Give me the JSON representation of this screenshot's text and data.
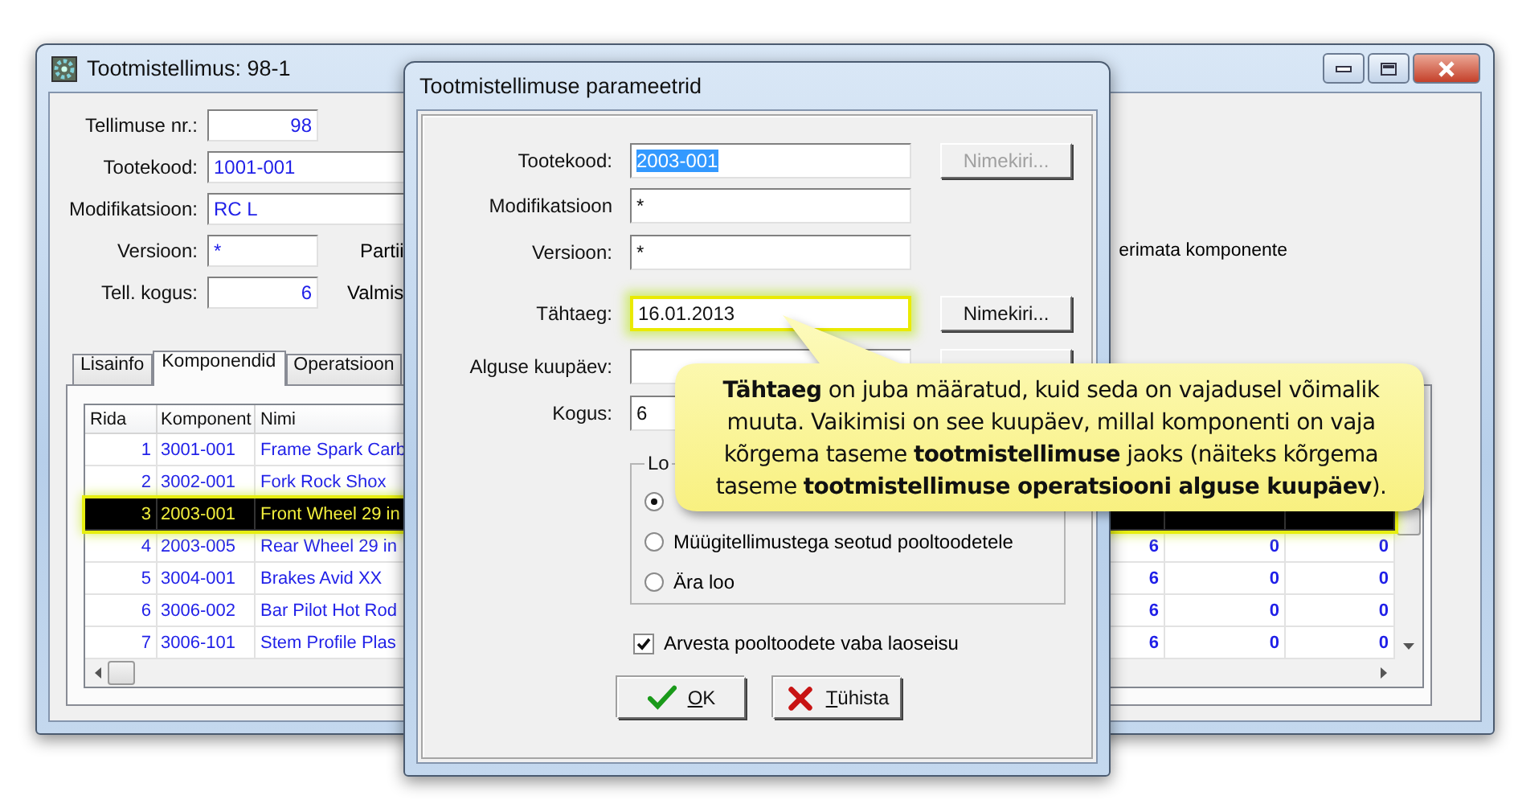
{
  "main_window": {
    "title": "Tootmistellimus: 98-1",
    "fields": [
      {
        "label": "Tellimuse nr.:",
        "value": "98",
        "kind": "number"
      },
      {
        "label": "Tootekood:",
        "value": "1001-001",
        "kind": "text"
      },
      {
        "label": "Modifikatsioon:",
        "value": "RC L",
        "kind": "text"
      },
      {
        "label": "Versioon:",
        "value": "*",
        "kind": "short",
        "side_label": "Partii",
        "far_label": "erimata komponente"
      },
      {
        "label": "Tell. kogus:",
        "value": "6",
        "kind": "number",
        "side_label": "Valmis"
      }
    ],
    "tabs": [
      {
        "label": "Lisainfo",
        "selected": false
      },
      {
        "label": "Komponendid",
        "selected": true
      },
      {
        "label": "Operatsioon",
        "selected": false
      }
    ],
    "table": {
      "columns": [
        "Rida",
        "Komponent",
        "Nimi"
      ],
      "rows": [
        {
          "cells": [
            "1",
            "3001-001",
            "Frame Spark Carb"
          ],
          "selected": false
        },
        {
          "cells": [
            "2",
            "3002-001",
            "Fork Rock Shox"
          ],
          "selected": false
        },
        {
          "cells": [
            "3",
            "2003-001",
            "Front Wheel 29 in"
          ],
          "selected": true
        },
        {
          "cells": [
            "4",
            "2003-005",
            "Rear Wheel 29 in",
            "6",
            "0",
            "0"
          ],
          "selected": false
        },
        {
          "cells": [
            "5",
            "3004-001",
            "Brakes Avid XX",
            "6",
            "0",
            "0"
          ],
          "selected": false
        },
        {
          "cells": [
            "6",
            "3006-002",
            "Bar Pilot Hot Rod",
            "6",
            "0",
            "0"
          ],
          "selected": false
        },
        {
          "cells": [
            "7",
            "3006-101",
            "Stem Profile Plas",
            "6",
            "0",
            "0"
          ],
          "selected": false
        }
      ]
    }
  },
  "dialog": {
    "title": "Tootmistellimuse parameetrid",
    "fields": [
      {
        "label": "Tootekood:",
        "value": "2003-001",
        "text_selected": true,
        "highlighted": false,
        "button": {
          "label": "Nimekiri...",
          "disabled": true
        }
      },
      {
        "label": "Modifikatsioon",
        "value": "*",
        "text_selected": false,
        "highlighted": false
      },
      {
        "label": "Versioon:",
        "value": "*",
        "text_selected": false,
        "highlighted": false
      },
      {
        "label": "Tähtaeg:",
        "value": "16.01.2013",
        "text_selected": false,
        "highlighted": true,
        "button": {
          "label": "Nimekiri...",
          "disabled": false
        }
      },
      {
        "label": "Alguse kuupäev:",
        "highlighted": false,
        "list_button": true
      },
      {
        "label": "Kogus:",
        "value": "6",
        "text_selected": false,
        "highlighted": false
      }
    ],
    "group": {
      "legend": "Lo",
      "options": [
        {
          "selected": true
        },
        {
          "label": "Müügitellimustega seotud pooltoodetele",
          "selected": false
        },
        {
          "label": "Ära loo",
          "selected": false
        }
      ]
    },
    "checkbox": {
      "label": "Arvesta pooltoodete vaba laoseisu",
      "checked": true
    },
    "buttons": [
      {
        "label": "OK",
        "kind": "confirm"
      },
      {
        "label": "Tühista",
        "kind": "cancel"
      }
    ]
  },
  "callout": {
    "text": "**Tähtaeg** on juba määratud, kuid seda on vajadusel võimalik muuta. Vaikimisi on see kuupäev, millal komponenti on vaja kõrgema taseme **tootmistellimuse** jaoks (näiteks kõrgema taseme **tootmistellimuse operatsiooni  alguse kuupäev**)."
  }
}
